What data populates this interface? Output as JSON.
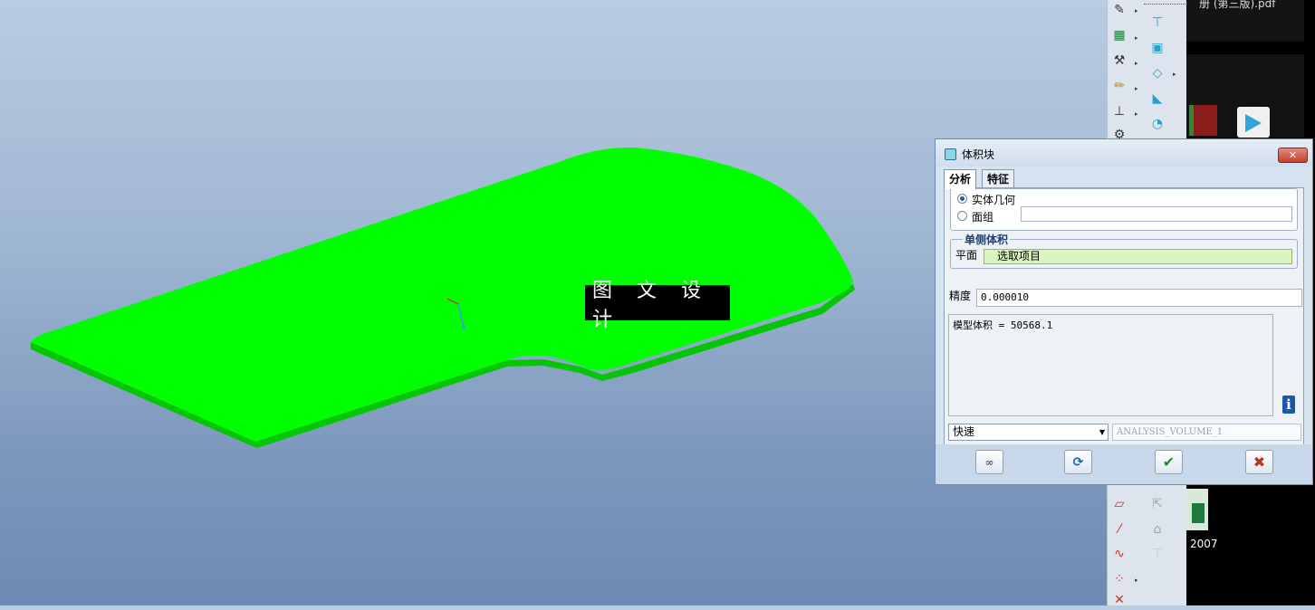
{
  "viewport": {
    "watermark_text": "图 文 设 计",
    "part_color": "#00ff00"
  },
  "desktop": {
    "pdf_text": "册 (第三版).pdf",
    "excel_label": "2007"
  },
  "dialog": {
    "title": "体积块",
    "tabs": [
      "分析",
      "特征"
    ],
    "geometry": {
      "option_solid": "实体几何",
      "option_quilt": "面组",
      "quilt_value": ""
    },
    "one_side": {
      "group_title": "单侧体积",
      "plane_label": "平面",
      "plane_collector": "选取项目"
    },
    "precision": {
      "label": "精度",
      "value": "0.000010"
    },
    "result_text": "模型体积 = 50568.1",
    "mode_select": "快速",
    "analysis_name": "ANALYSIS_VOLUME_1",
    "buttons": {
      "preview": "glasses-icon",
      "repeat": "refresh-icon",
      "ok": "check-icon",
      "cancel": "close-icon"
    }
  },
  "toolbar": {
    "icons": [
      "sketch-icon",
      "datum-axis-icon",
      "hammer-icon",
      "pencil-icon",
      "pin-icon",
      "gear-icon",
      "datum-plane-icon",
      "datum-axis-line-icon",
      "curve-icon",
      "datum-point-icon",
      "coordinate-icon"
    ]
  }
}
